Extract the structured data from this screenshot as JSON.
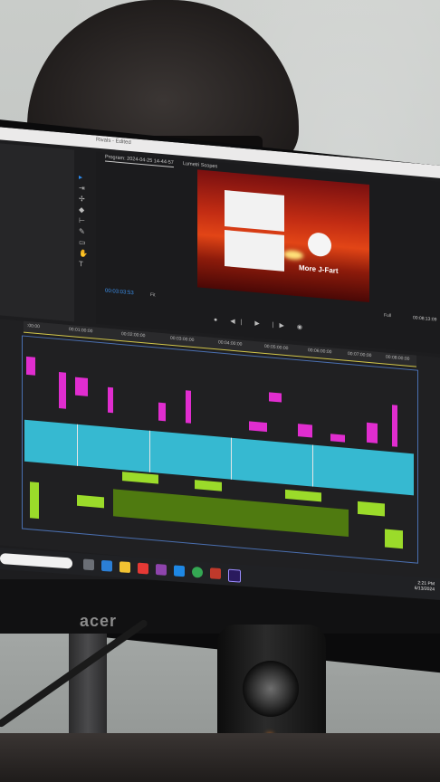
{
  "scene": {
    "monitor_brand": "acer",
    "app_title": "Rivals - Edited",
    "program_tab": "Program: 2024-04-25 14-44-57",
    "scopes_tab": "Lumetri Scopes",
    "viewer_caption": "More J-Fart",
    "timecode_left": "00:03:03:53",
    "fit_label": "Fit",
    "timecode_right": "00:08:13:09",
    "full_label": "Full",
    "ruler_ticks": [
      ":00:00",
      "00:01:00:00",
      "00:02:00:00",
      "00:03:00:00",
      "00:04:00:00",
      "00:05:00:00",
      "00:06:00:00",
      "00:07:00:00",
      "00:08:00:00"
    ],
    "clock_time": "2:21 PM",
    "clock_date": "6/13/2024",
    "taskbar_icons": [
      "file-explorer-icon",
      "store-icon",
      "folder-icon",
      "app-icon",
      "app-icon",
      "app-icon",
      "chrome-icon",
      "app-icon",
      "premiere-icon"
    ]
  },
  "colors": {
    "magenta": "#e02dcf",
    "cyan": "#36b9d1",
    "green": "#9bdb2a",
    "playhead": "#2d8cf0"
  }
}
